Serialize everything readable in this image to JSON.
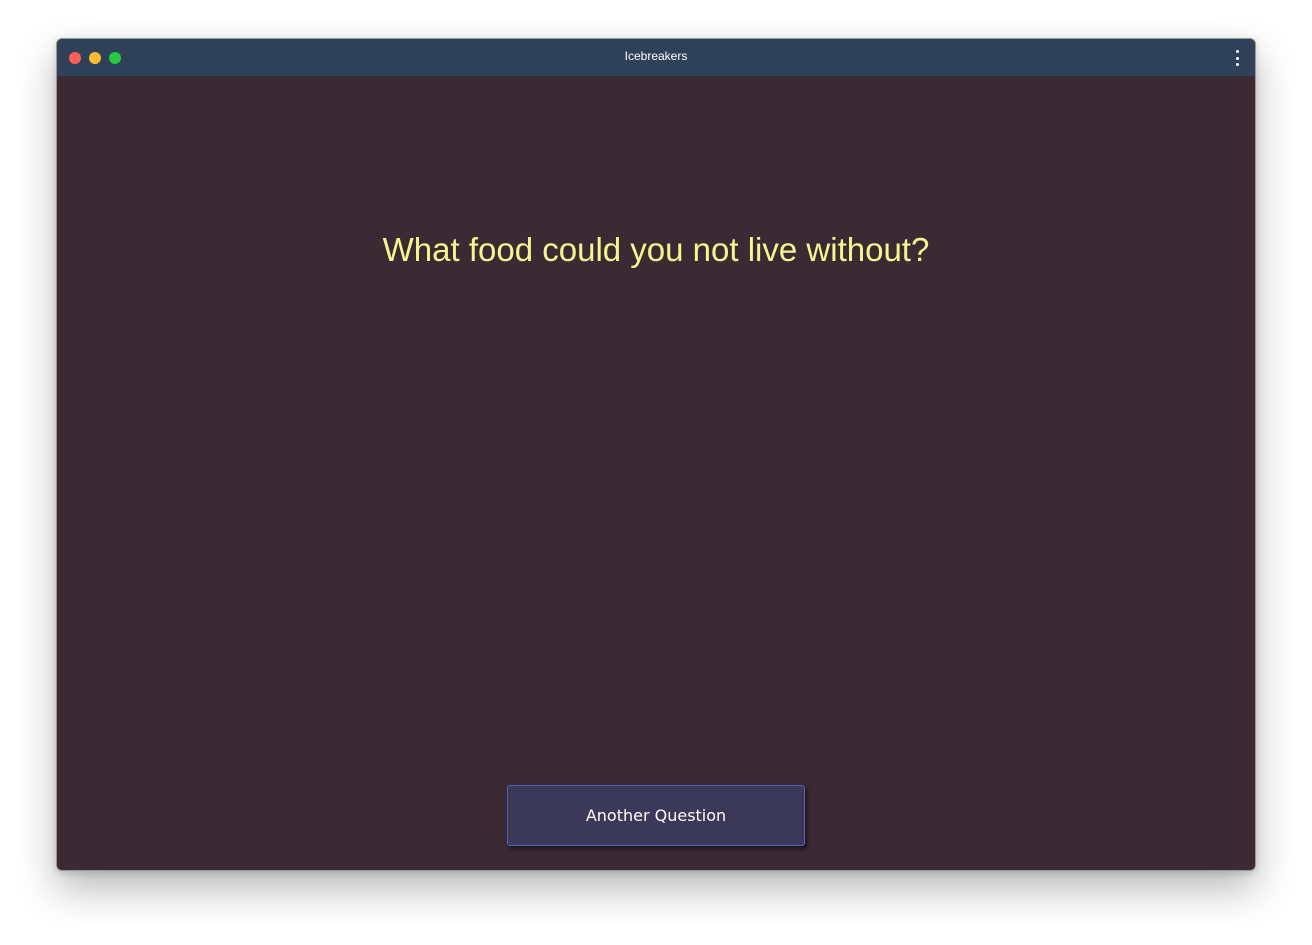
{
  "window": {
    "title": "Icebreakers"
  },
  "titlebar": {
    "menu_icon": "more-vertical-icon"
  },
  "main": {
    "question": "What food could you not live without?",
    "another_button_label": "Another Question"
  },
  "colors": {
    "titlebar_bg": "#2f4159",
    "content_bg": "#3b2a33",
    "question_text": "#f7f58f",
    "button_bg": "#3b3858",
    "button_border": "#5560c8"
  }
}
